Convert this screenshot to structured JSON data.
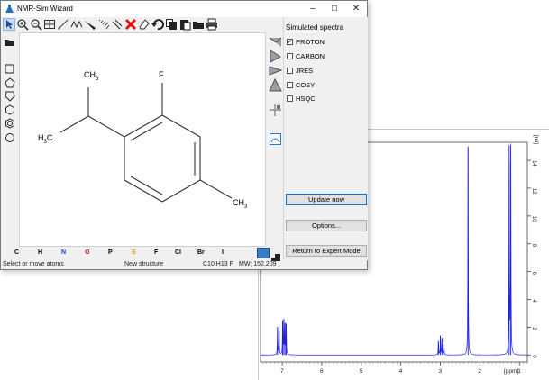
{
  "window": {
    "title": "NMR-Sim Wizard",
    "minimize": "–",
    "maximize": "☐",
    "close": "✕"
  },
  "right_panel": {
    "header": "Simulated spectra",
    "checks": [
      {
        "label": "PROTON",
        "checked": true,
        "mark": "✓"
      },
      {
        "label": "CARBON",
        "checked": false,
        "mark": ""
      },
      {
        "label": "JRES",
        "checked": false,
        "mark": ""
      },
      {
        "label": "COSY",
        "checked": false,
        "mark": ""
      },
      {
        "label": "HSQC",
        "checked": false,
        "mark": ""
      }
    ],
    "update_button": "Update now",
    "options_button": "Options...",
    "return_button": "Return to Expert Mode"
  },
  "molecule": {
    "atoms": [
      {
        "main": "CH",
        "sub": "3"
      },
      {
        "main": "F",
        "sub": ""
      },
      {
        "main": "H",
        "sub": "3",
        "tail": "C"
      },
      {
        "main": "CH",
        "sub": "3"
      }
    ]
  },
  "elements": [
    {
      "symbol": "C",
      "color": "#000000"
    },
    {
      "symbol": "H",
      "color": "#000000"
    },
    {
      "symbol": "N",
      "color": "#1f3fd0"
    },
    {
      "symbol": "O",
      "color": "#e01010"
    },
    {
      "symbol": "P",
      "color": "#000000"
    },
    {
      "symbol": "S",
      "color": "#c8a000"
    },
    {
      "symbol": "F",
      "color": "#000000"
    },
    {
      "symbol": "Cl",
      "color": "#000000"
    },
    {
      "symbol": "Br",
      "color": "#000000"
    },
    {
      "symbol": "I",
      "color": "#000000"
    }
  ],
  "status": {
    "mode": "Select or move atoms",
    "structure": "New structure",
    "formula": "C10 H13 F",
    "mw": "MW: 152.209"
  },
  "icons": {
    "toolbar": [
      "select-arrow-icon",
      "zoom-in-icon",
      "zoom-out-icon",
      "grid-icon",
      "bond-pencil-icon",
      "chain-icon",
      "wedge-icon",
      "hash-wedge-icon",
      "bond-type-icon",
      "delete-x-icon",
      "eraser-icon",
      "undo-icon",
      "copy-icon",
      "paste-icon",
      "open-folder-icon",
      "print-icon"
    ],
    "left": [
      "square-ring-icon",
      "pentagon-ring-icon",
      "hexagon-ring-icon",
      "benzene-ring-icon",
      "cyclopropane-icon",
      "circle-ring-icon"
    ]
  },
  "spectrum": {
    "y_unit": "[rel]",
    "x_unit": "[ppm]",
    "y_ticks": [
      "0",
      "2",
      "4",
      "6",
      "8",
      "10",
      "12",
      "14"
    ],
    "x_ticks": [
      "7",
      "6",
      "5",
      "4",
      "3",
      "2",
      "1"
    ],
    "line_color": "#2020e0"
  },
  "chart_data": {
    "type": "line",
    "xlabel": "[ppm]",
    "ylabel": "[rel]",
    "xlim": [
      7.55,
      0.8
    ],
    "ylim": [
      -0.5,
      15.3
    ],
    "x_reversed": true,
    "series": [
      {
        "peaks": [
          {
            "x": 7.12,
            "y": 2.0
          },
          {
            "x": 7.08,
            "y": 2.2
          },
          {
            "x": 6.99,
            "y": 2.4
          },
          {
            "x": 6.96,
            "y": 2.6
          },
          {
            "x": 6.93,
            "y": 2.3
          },
          {
            "x": 6.9,
            "y": 2.2
          },
          {
            "x": 3.05,
            "y": 1.0
          },
          {
            "x": 3.0,
            "y": 1.4
          },
          {
            "x": 2.96,
            "y": 1.2
          },
          {
            "x": 2.91,
            "y": 0.8
          },
          {
            "x": 2.3,
            "y": 15.0
          },
          {
            "x": 1.26,
            "y": 15.1
          },
          {
            "x": 1.22,
            "y": 15.0
          }
        ]
      }
    ]
  }
}
